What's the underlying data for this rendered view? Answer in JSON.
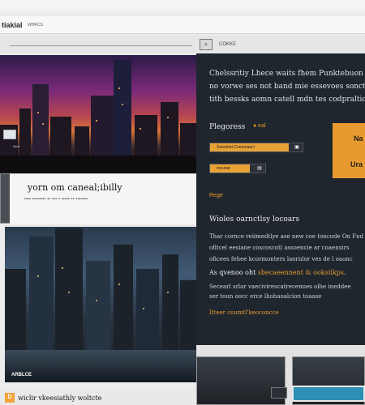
{
  "topbar": {
    "items": [
      "",
      "",
      "",
      "",
      "",
      ""
    ]
  },
  "header": {
    "logo": "tiakial",
    "nav": [
      "WHRCS",
      "",
      "",
      ""
    ],
    "search_button_glyph": "⌕",
    "search_label": "COKKE"
  },
  "hero_image": {
    "caption": "Asof"
  },
  "feature_card": {
    "title": "yorn om caneal;ibilly",
    "subtitle": "▪▪▪▪ ▪▪▪▪▪▪▪▪ ▪▪ ▪▪▪ ▪ ▪▪▪▪▪ ▪▪ ▪▪▪▪▪▪▪"
  },
  "city_image": {
    "caption": "ARBLCE"
  },
  "footer": {
    "icon_glyph": "D",
    "text": "wiclir vkeesiathly woltcte"
  },
  "panel": {
    "intro_lines": [
      "Chelssritiy Lhece waits fhem Punktebuon wi",
      "no vorwe ses not band mie essevoes sonctc",
      "tith bessks aomn catell mdn tes codpraltic"
    ],
    "progress_label": "Plegoress",
    "progress_value": "● eal",
    "bars": [
      {
        "text": "Saoobtet Coomeaact",
        "fill_fraction": 0.85,
        "icon": "▣"
      },
      {
        "text": "rocuoar",
        "fill_fraction": 0.72,
        "icon": "▤"
      }
    ],
    "tile_labels": [
      "Na",
      "Ura"
    ],
    "kicker": "Rege",
    "section_title": "Wioles oarnctlsy locoars",
    "body_lines": [
      "Thar cornce reiimedtlye ase new coe toncode On Fnd",
      "ofitcel eesiane coscoscotl assoencie ar  coaensirs",
      "oficees fehee kcormonters laornlor ves de l  oaonc"
    ],
    "accent_prefix": "As qvenoo oht ",
    "accent_emphasis": "sbecaeennent & ooksiikps",
    "accent_suffix": ".",
    "body_lines_2": [
      "Secearl srlar vaecivirescatrecennes olhe ineddee",
      "ser toun oocc erce lhohaoalcion toaase"
    ],
    "link_line": "Itteer coumtl'keoconcce"
  },
  "colors": {
    "accent": "#e89a2e",
    "panel_bg": "#20262e",
    "link_blue": "#2e8fb4"
  }
}
